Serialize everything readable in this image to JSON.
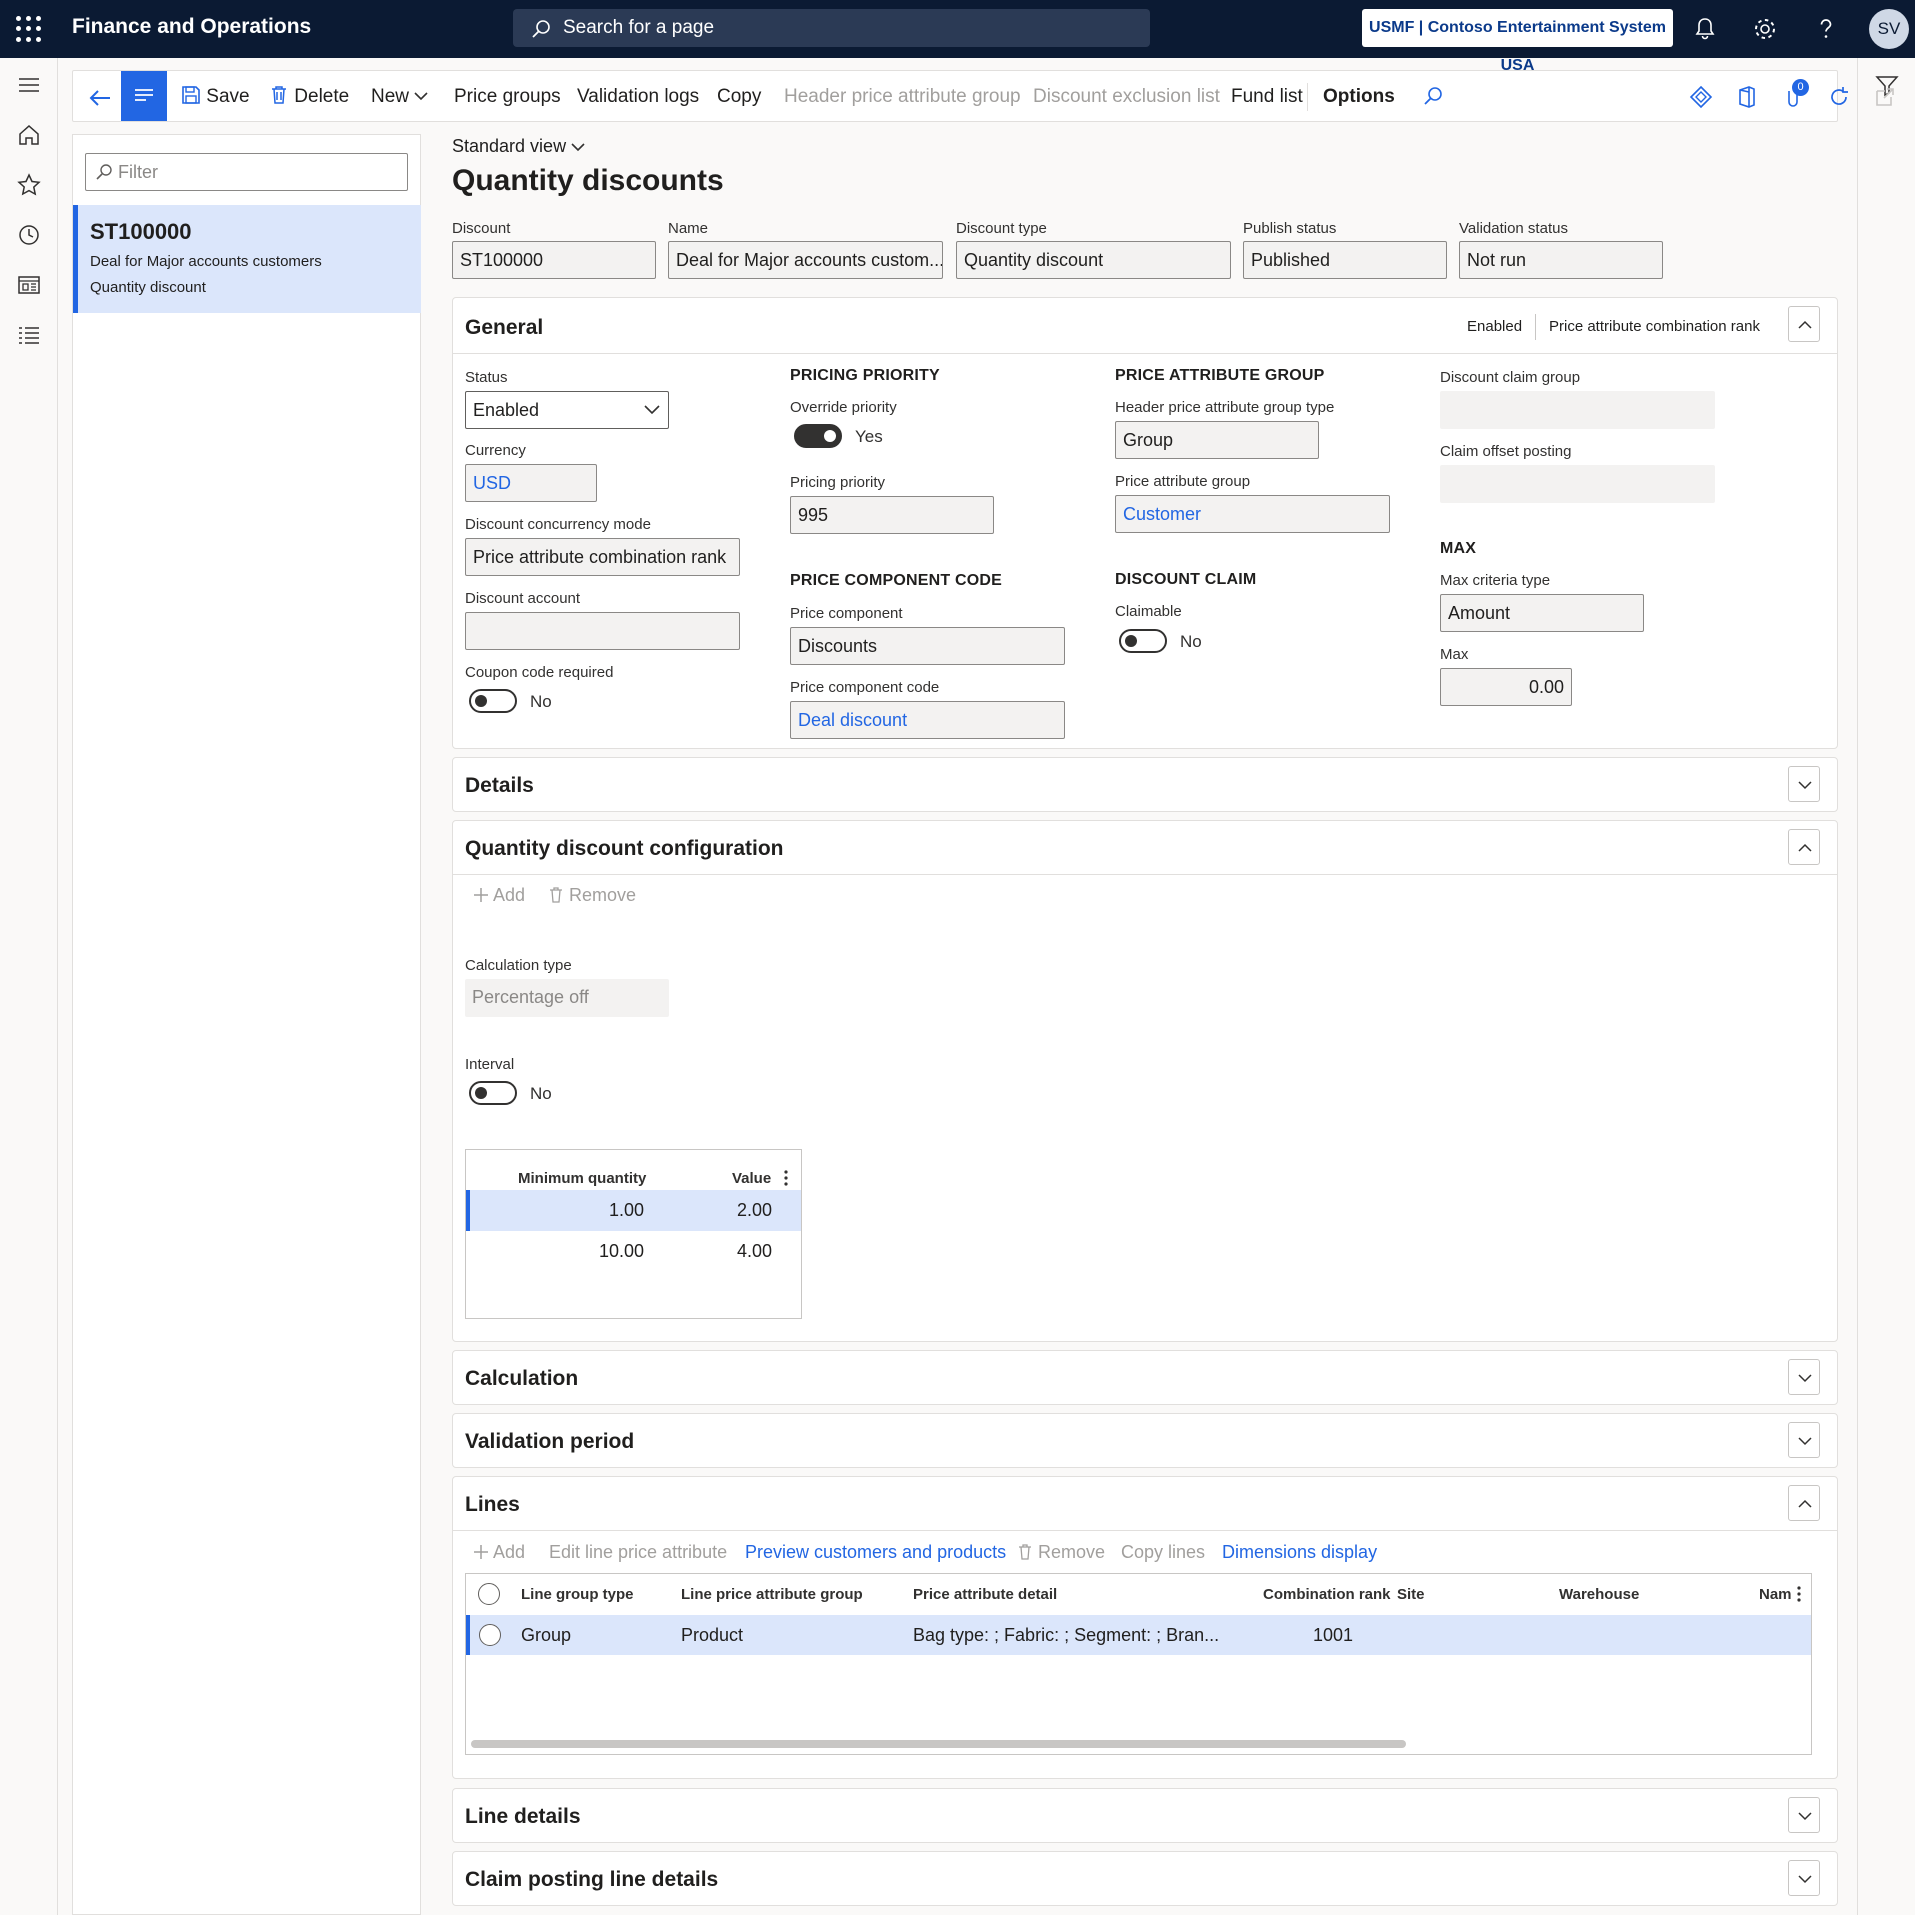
{
  "topbar": {
    "app_title": "Finance and Operations",
    "search_placeholder": "Search for a page",
    "company": "USMF | Contoso Entertainment System USA",
    "avatar_initials": "SV"
  },
  "actions": {
    "save": "Save",
    "delete": "Delete",
    "new": "New",
    "price_groups": "Price groups",
    "validation_logs": "Validation logs",
    "copy": "Copy",
    "header_price_attribute_group": "Header price attribute group",
    "discount_exclusion_list": "Discount exclusion list",
    "fund_list": "Fund list",
    "options": "Options",
    "badge_count": "0"
  },
  "list": {
    "filter_placeholder": "Filter",
    "items": [
      {
        "id": "ST100000",
        "name": "Deal for Major accounts customers",
        "type": "Quantity discount"
      }
    ]
  },
  "page": {
    "view": "Standard view",
    "title": "Quantity discounts"
  },
  "header": {
    "discount": {
      "label": "Discount",
      "value": "ST100000"
    },
    "name": {
      "label": "Name",
      "value": "Deal for Major accounts custom..."
    },
    "discount_type": {
      "label": "Discount type",
      "value": "Quantity discount"
    },
    "publish_status": {
      "label": "Publish status",
      "value": "Published"
    },
    "validation_status": {
      "label": "Validation status",
      "value": "Not run"
    }
  },
  "general": {
    "title": "General",
    "summary_status": "Enabled",
    "summary_mode": "Price attribute combination rank",
    "status": {
      "label": "Status",
      "value": "Enabled"
    },
    "currency": {
      "label": "Currency",
      "value": "USD"
    },
    "concurrency": {
      "label": "Discount concurrency mode",
      "value": "Price attribute combination rank"
    },
    "discount_account": {
      "label": "Discount account",
      "value": ""
    },
    "coupon": {
      "label": "Coupon code required",
      "value": "No"
    },
    "pricing_priority_heading": "PRICING PRIORITY",
    "override_priority": {
      "label": "Override priority",
      "value": "Yes"
    },
    "pricing_priority": {
      "label": "Pricing priority",
      "value": "995"
    },
    "price_component_heading": "PRICE COMPONENT CODE",
    "price_component": {
      "label": "Price component",
      "value": "Discounts"
    },
    "price_component_code": {
      "label": "Price component code",
      "value": "Deal discount"
    },
    "price_attribute_heading": "PRICE ATTRIBUTE GROUP",
    "header_group_type": {
      "label": "Header price attribute group type",
      "value": "Group"
    },
    "price_attribute_group": {
      "label": "Price attribute group",
      "value": "Customer"
    },
    "discount_claim_heading": "DISCOUNT CLAIM",
    "claimable": {
      "label": "Claimable",
      "value": "No"
    },
    "claim_group": {
      "label": "Discount claim group",
      "value": ""
    },
    "claim_offset": {
      "label": "Claim offset posting",
      "value": ""
    },
    "max_heading": "MAX",
    "max_criteria": {
      "label": "Max criteria type",
      "value": "Amount"
    },
    "max": {
      "label": "Max",
      "value": "0.00"
    }
  },
  "sections": {
    "details": "Details",
    "qdc": "Quantity discount configuration",
    "calculation": "Calculation",
    "validation_period": "Validation period",
    "lines": "Lines",
    "line_details": "Line details",
    "claim_posting": "Claim posting line details"
  },
  "qdc": {
    "add": "Add",
    "remove": "Remove",
    "calc_type": {
      "label": "Calculation type",
      "value": "Percentage off"
    },
    "interval": {
      "label": "Interval",
      "value": "No"
    },
    "grid": {
      "col_min": "Minimum quantity",
      "col_value": "Value",
      "rows": [
        {
          "min": "1.00",
          "value": "2.00"
        },
        {
          "min": "10.00",
          "value": "4.00"
        }
      ]
    }
  },
  "lines": {
    "add": "Add",
    "edit_attr": "Edit line price attribute",
    "preview": "Preview customers and products",
    "remove": "Remove",
    "copy_lines": "Copy lines",
    "dimensions": "Dimensions display",
    "columns": {
      "line_group_type": "Line group type",
      "line_price_attr_group": "Line price attribute group",
      "detail": "Price attribute detail",
      "rank": "Combination rank",
      "site": "Site",
      "warehouse": "Warehouse",
      "name": "Nam"
    },
    "rows": [
      {
        "line_group_type": "Group",
        "line_price_attr_group": "Product",
        "detail": "Bag type: ; Fabric: ; Segment: ; Bran...",
        "rank": "1001",
        "site": "",
        "warehouse": "",
        "name": ""
      }
    ]
  }
}
